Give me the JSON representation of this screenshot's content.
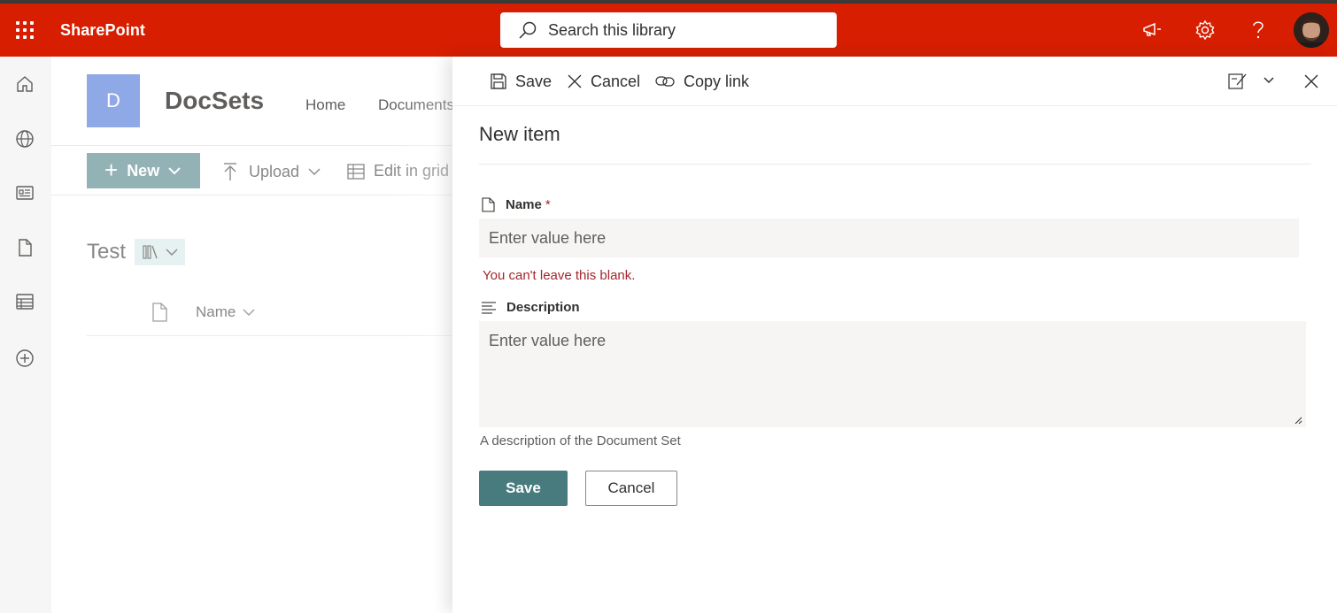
{
  "suite": {
    "app_name": "SharePoint",
    "search_placeholder": "Search this library",
    "icons": [
      "app-launcher-icon",
      "megaphone-icon",
      "settings-icon",
      "help-icon"
    ]
  },
  "rail": {
    "items": [
      "home-icon",
      "globe-icon",
      "news-icon",
      "document-icon",
      "list-icon",
      "create-icon"
    ]
  },
  "site": {
    "logo_letter": "D",
    "title": "DocSets",
    "nav": [
      "Home",
      "Documents"
    ],
    "commands": {
      "new": "New",
      "upload": "Upload",
      "edit_grid": "Edit in grid"
    },
    "library_title": "Test",
    "column_name": "Name"
  },
  "panel": {
    "toolbar": {
      "save": "Save",
      "cancel": "Cancel",
      "copy_link": "Copy link"
    },
    "title": "New item",
    "fields": {
      "name": {
        "label": "Name",
        "required_mark": "*",
        "placeholder": "Enter value here",
        "error": "You can't leave this blank."
      },
      "description": {
        "label": "Description",
        "placeholder": "Enter value here",
        "hint": "A description of the Document Set"
      }
    },
    "buttons": {
      "save": "Save",
      "cancel": "Cancel"
    }
  },
  "colors": {
    "suite_bar": "#d71e00",
    "primary_button": "#487b7e",
    "error": "#a4262c"
  }
}
